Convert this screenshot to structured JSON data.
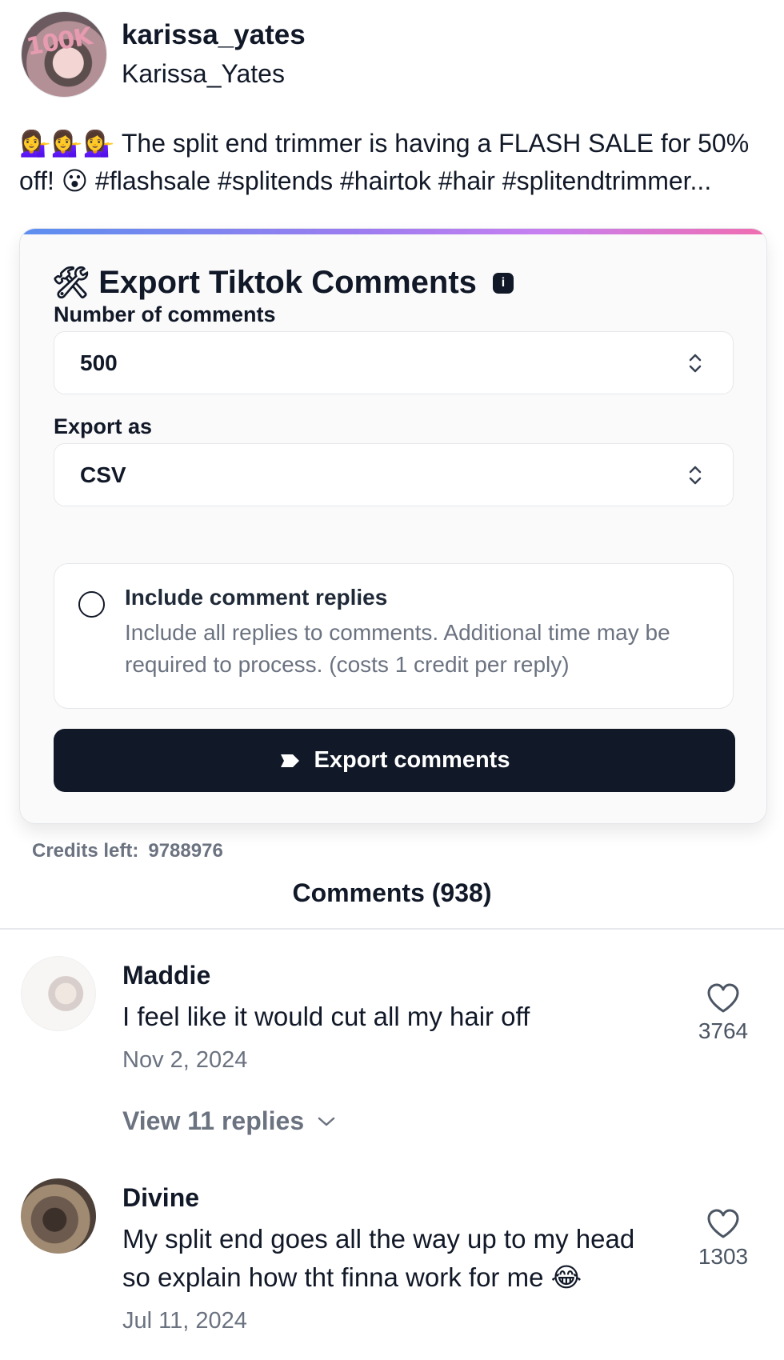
{
  "profile": {
    "username": "karissa_yates",
    "display_name": "Karissa_Yates",
    "avatar_sticker_text": "100K"
  },
  "caption": "💁‍♀️💁‍♀️💁‍♀️ The split end trimmer is having a FLASH SALE for 50% off! 😮 #flashsale #splitends #hairtok #hair #splitendtrimmer...",
  "export_card": {
    "title": "Export Tiktok Comments",
    "title_icon": "🛠",
    "info_icon": "i",
    "number_label": "Number of comments",
    "number_value": "500",
    "format_label": "Export as",
    "format_value": "CSV",
    "replies_title": "Include comment replies",
    "replies_desc": "Include all replies to comments. Additional time may be required to process. (costs 1 credit per reply)",
    "replies_checked": false,
    "button_label": "Export comments"
  },
  "credits": {
    "label": "Credits left:",
    "value": "9788976"
  },
  "comments_heading": "Comments (938)",
  "comments": [
    {
      "name": "Maddie",
      "text": "I feel like it would cut all my hair off",
      "date": "Nov 2, 2024",
      "likes": "3764",
      "view_replies": "View 11 replies"
    },
    {
      "name": "Divine",
      "text": "My split end goes all the way up to my head so explain how tht finna work for me 😂",
      "date": "Jul 11, 2024",
      "likes": "1303"
    }
  ],
  "colors": {
    "primary_button": "#111827",
    "muted_text": "#6b7280",
    "accent_gradient_start": "#5b8ff0",
    "accent_gradient_end": "#f06db0"
  }
}
